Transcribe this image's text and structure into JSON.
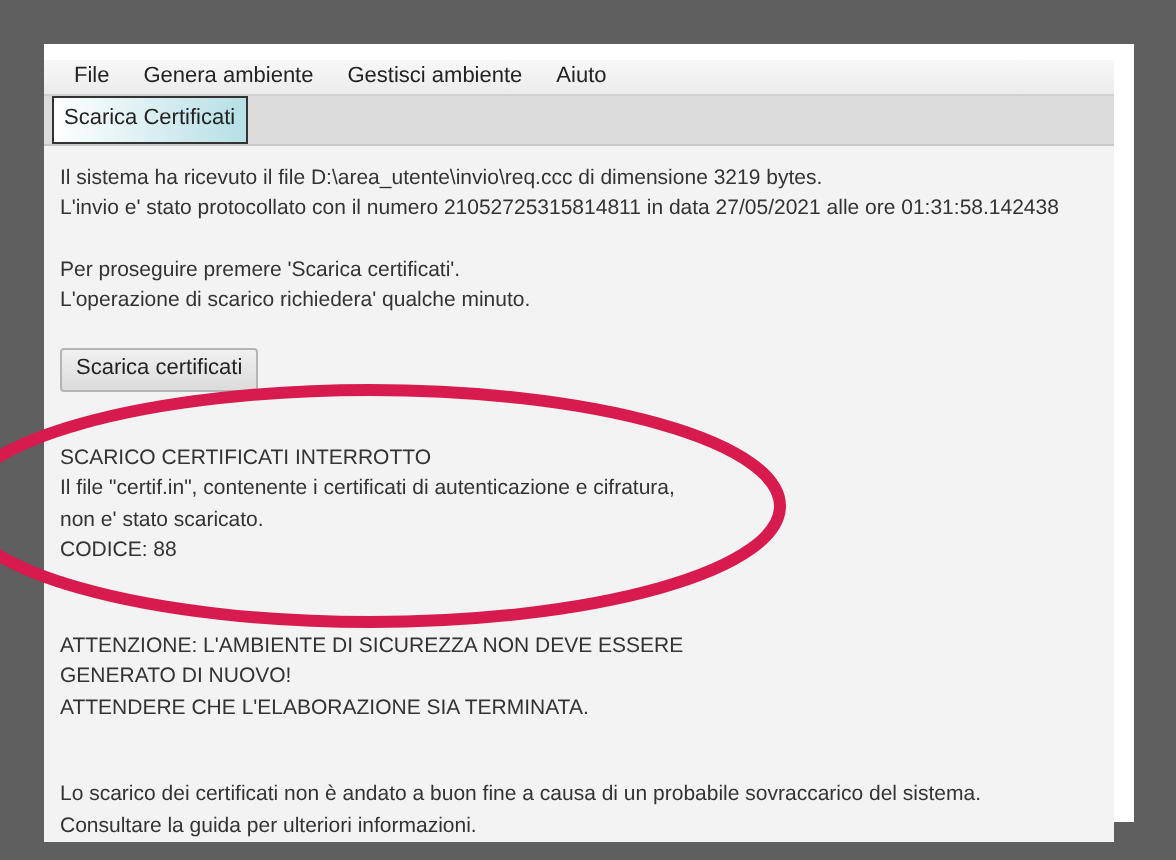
{
  "menu": [
    {
      "label": "File"
    },
    {
      "label": "Genera ambiente"
    },
    {
      "label": "Gestisci ambiente"
    },
    {
      "label": "Aiuto"
    }
  ],
  "tabs": [
    {
      "label": "Scarica Certificati",
      "selected": true
    }
  ],
  "paragraphs": [
    [
      "Il sistema ha ricevuto il file D:\\area_utente\\invio\\req.ccc di dimensione 3219 bytes.",
      "L'invio e' stato protocollato con il numero 21052725315814811 in data 27/05/2021 alle ore 01:31:58.142438"
    ],
    [
      "Per proseguire premere 'Scarica certificati'.",
      "L'operazione di scarico richiedera' qualche minuto."
    ]
  ],
  "button": {
    "label": "Scarica certificati"
  },
  "error": [
    "SCARICO CERTIFICATI INTERROTTO",
    "Il file \"certif.in\", contenente i certificati di autenticazione e cifratura,",
    "non e' stato scaricato.",
    "CODICE: 88"
  ],
  "warning": [
    "ATTENZIONE: L'AMBIENTE DI SICUREZZA NON DEVE ESSERE",
    "GENERATO DI NUOVO!",
    "ATTENDERE CHE L'ELABORAZIONE SIA TERMINATA."
  ],
  "footer": [
    "Lo scarico dei certificati non è andato a buon fine a causa di un probabile sovraccarico del sistema.",
    "Consultare la guida per ulteriori informazioni."
  ]
}
